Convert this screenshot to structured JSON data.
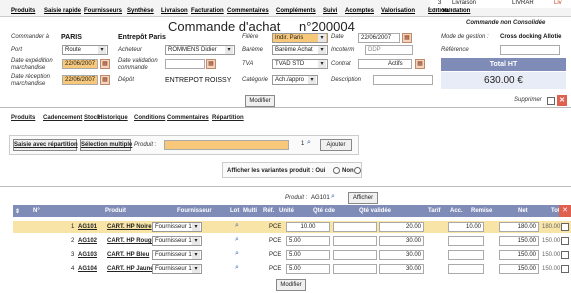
{
  "menu": [
    "Produits",
    "Saisie rapide",
    "Fournisseurs",
    "Synthèse",
    "Livraison",
    "Facturation",
    "Commentaires",
    "Compléments",
    "Suivi",
    "Acomptes",
    "Valorisation",
    "Edition",
    "Validation"
  ],
  "tabs_top": {
    "num": "3",
    "livraison": "Livraison",
    "livrar": "LIVRAR",
    "liv": "Liv"
  },
  "header": {
    "title": "Commande d'achat",
    "number": "n°200004",
    "status": "Commande non Consolidée",
    "commander_label": "Commander à",
    "commander_value": "PARIS",
    "entrepot": "Entrepôt Paris",
    "filiere_label": "Filière",
    "filiere_value": "Indir. Paris",
    "date_label": "Date",
    "date_value": "22/06/2007",
    "mode_label": "Mode de gestion :",
    "mode_value": "Cross docking Allotie",
    "port_label": "Port",
    "port_value": "Route",
    "acheteur_label": "Acheteur",
    "acheteur_value": "ROMMENS Didier",
    "bareme_label": "Barème",
    "bareme_value": "Barème Achat",
    "incoterm_label": "Incoterm",
    "incoterm_value": "DDP",
    "reference_label": "Référence",
    "date_exp_label": "Date expédition marchandise",
    "date_exp_value": "22/06/2007",
    "date_val_label": "Date validation commande",
    "tva_label": "TVA",
    "tva_value": "TVAD STD",
    "contrat_label": "Contrat",
    "actifs_label": "Actifs",
    "total_ht_label": "Total HT",
    "total_ht_value": "630.00 €",
    "date_rec_label": "Date réception marchandise",
    "date_rec_value": "22/06/2007",
    "depot_label": "Dépôt",
    "depot_value": "ENTREPOT ROISSY",
    "categorie_label": "Catégorie",
    "categorie_value": "Ach./appro",
    "description_label": "Description",
    "modifier_label": "Modifier",
    "supprimer_label": "Supprimer"
  },
  "subtabs": [
    "Produits",
    "Cadencement",
    "Stock",
    "Historique",
    "Conditions",
    "Commentaires",
    "Répartition"
  ],
  "toolbar": {
    "saisie_rep": "Saisie avec répartition",
    "selection_multiple": "Sélection multiple",
    "produit_label": "Produit :",
    "qty_value": "1",
    "ajouter": "Ajouter"
  },
  "variantes": {
    "label": "Afficher les variantes produit : Oui",
    "non": "Non"
  },
  "filter": {
    "produit_label": "Produit :",
    "produit_value": "AG101",
    "afficher": "Afficher"
  },
  "columns": [
    "N°",
    "Produit",
    "Fournisseur",
    "Lot",
    "Multi",
    "Réf.",
    "Unité",
    "Qté cde",
    "Qté validée",
    "Tarif",
    "Acc.",
    "Remise",
    "Net",
    "Total"
  ],
  "rows": [
    {
      "n": "1",
      "code": "AG101",
      "name": "CART. HP Noire",
      "fournisseur": "Fournisseur 1",
      "unite": "PCE",
      "qte": "10.00",
      "tarif": "20.00",
      "remise": "10.00",
      "net": "180.00",
      "total": "180.00"
    },
    {
      "n": "2",
      "code": "AG102",
      "name": "CART. HP Rouge",
      "fournisseur": "Fournisseur 1",
      "unite": "PCE",
      "qte": "5.00",
      "tarif": "30.00",
      "remise": "",
      "net": "150.00",
      "total": "150.00"
    },
    {
      "n": "3",
      "code": "AG103",
      "name": "CART. HP Bleu",
      "fournisseur": "Fournisseur 1",
      "unite": "PCE",
      "qte": "5.00",
      "tarif": "30.00",
      "remise": "",
      "net": "150.00",
      "total": "150.00"
    },
    {
      "n": "4",
      "code": "AG104",
      "name": "CART. HP Jaune",
      "fournisseur": "Fournisseur 1",
      "unite": "PCE",
      "qte": "5.00",
      "tarif": "30.00",
      "remise": "",
      "net": "150.00",
      "total": "150.00"
    }
  ],
  "bottom": {
    "modifier": "Modifier"
  },
  "colors": {
    "accent": "#7f8cb8",
    "selected_row": "#f8e4a6",
    "orange_input": "#f8c87a"
  }
}
